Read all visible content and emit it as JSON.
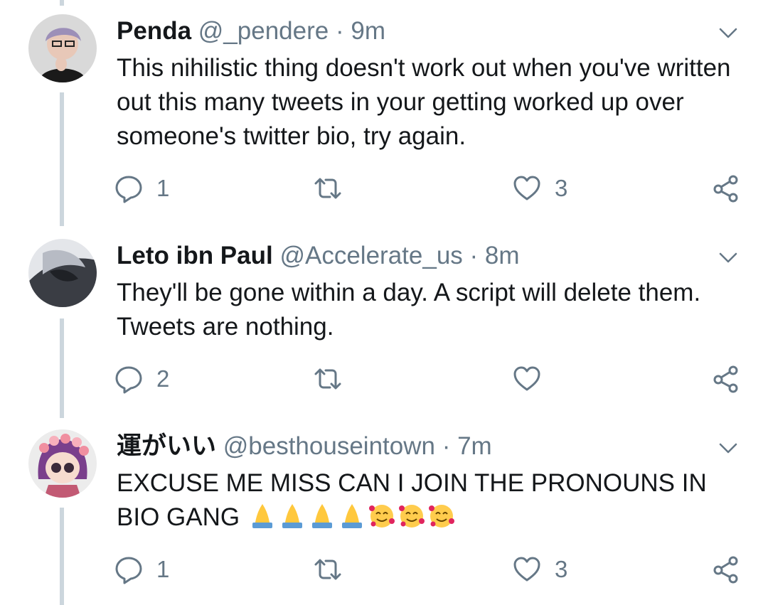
{
  "colors": {
    "text": "#14171a",
    "muted": "#657786",
    "line": "#ccd6dd"
  },
  "tweets": [
    {
      "name": "Penda",
      "handle": "@_pendere",
      "time": "9m",
      "text": "This nihilistic thing doesn't work out when you've written out this many tweets in your getting worked up over someone's twitter bio, try again.",
      "replies": "1",
      "retweets": "",
      "likes": "3",
      "avatar_icon": "avatar-penda"
    },
    {
      "name": "Leto ibn Paul",
      "handle": "@Accelerate_us",
      "time": "8m",
      "text": "They'll be gone within a day. A script will delete them. Tweets are nothing.",
      "replies": "2",
      "retweets": "",
      "likes": "",
      "avatar_icon": "avatar-leto"
    },
    {
      "name": "運がいい",
      "handle": "@besthouseintown",
      "time": "7m",
      "text": "EXCUSE ME MISS CAN I JOIN THE PRONOUNS IN BIO GANG",
      "emojis": [
        "folded-hands",
        "folded-hands",
        "folded-hands",
        "folded-hands",
        "smiling-face-with-hearts",
        "smiling-face-with-hearts",
        "smiling-face-with-hearts"
      ],
      "replies": "1",
      "retweets": "",
      "likes": "3",
      "avatar_icon": "avatar-besthouse"
    }
  ],
  "separator": "·"
}
